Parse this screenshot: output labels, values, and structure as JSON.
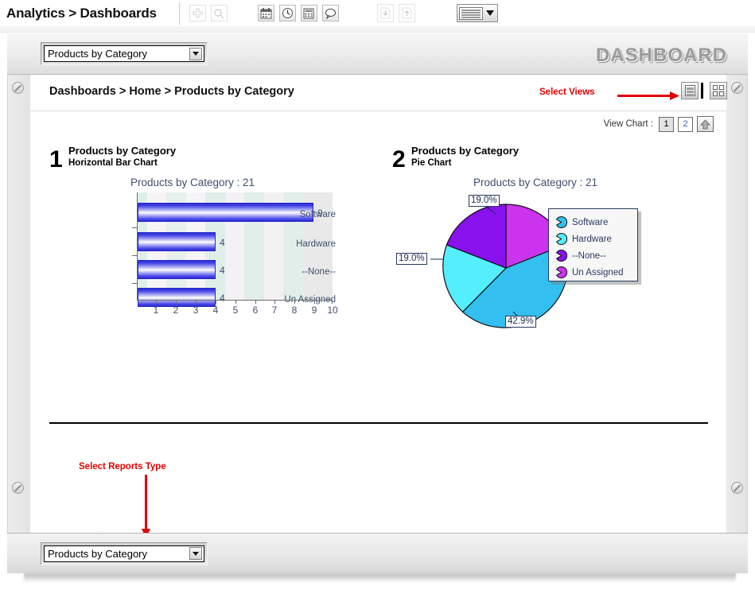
{
  "appbar": {
    "title": "Analytics > Dashboards",
    "icons": [
      {
        "name": "add-icon",
        "glyph": "plus",
        "disabled": true
      },
      {
        "name": "search-icon",
        "glyph": "magnifier",
        "disabled": true
      },
      {
        "name": "calendar-icon",
        "glyph": "calendar",
        "disabled": false
      },
      {
        "name": "clock-icon",
        "glyph": "clock",
        "disabled": false
      },
      {
        "name": "calculator-icon",
        "glyph": "calculator",
        "disabled": false
      },
      {
        "name": "comment-icon",
        "glyph": "speech-bubble",
        "disabled": false
      },
      {
        "name": "download-icon",
        "glyph": "down-arrow",
        "disabled": true
      },
      {
        "name": "upload-icon",
        "glyph": "up-arrow",
        "disabled": true
      }
    ],
    "view_select_label": "list-view-dropdown"
  },
  "top_strip": {
    "dashboard_select": {
      "value": "Products by Category",
      "placeholder": "Products by Category"
    },
    "brand": "DASHBOARD"
  },
  "content": {
    "breadcrumb": "Dashboards > Home > Products by Category",
    "select_views_label": "Select Views",
    "view_icons": [
      {
        "name": "view-list-icon",
        "active": true
      },
      {
        "name": "view-grid-icon",
        "active": false
      }
    ],
    "view_chart": {
      "label": "View Chart :",
      "buttons": [
        "1",
        "2"
      ],
      "active": "1",
      "collapse_icon": "up-arrow-icon"
    },
    "divider": true,
    "select_reports_label": "Select Reports Type"
  },
  "bottom_strip": {
    "report_select": {
      "value": "Products by Category",
      "placeholder": "Products by Category"
    }
  },
  "colors": {
    "software": "#33bfef",
    "hardware": "#55eeff",
    "none": "#8811ee",
    "unassigned": "#cc33ee",
    "bar_blue": "#2a2ad4",
    "annotation_red": "#e00000",
    "chart_text": "#414f70"
  },
  "chart_data": [
    {
      "type": "bar",
      "index": "1",
      "heading": "Products by Category",
      "subheading": "Horizontal Bar Chart",
      "title": "Products by Category : 21",
      "orientation": "horizontal",
      "categories": [
        "Software",
        "Hardware",
        "--None--",
        "Un Assigned"
      ],
      "values": [
        9,
        4,
        4,
        4
      ],
      "data_labels": [
        "9",
        "4",
        "4",
        "4"
      ],
      "xlabel": "",
      "ylabel": "",
      "xlim": [
        0,
        10
      ],
      "xticks": [
        "1",
        "2",
        "3",
        "4",
        "5",
        "6",
        "7",
        "8",
        "9",
        "10"
      ],
      "grid": "alternating-vertical-bands",
      "total": 21
    },
    {
      "type": "pie",
      "index": "2",
      "heading": "Products by Category",
      "subheading": "Pie Chart",
      "title": "Products by Category : 21",
      "labels": [
        "Software",
        "Hardware",
        "--None--",
        "Un Assigned"
      ],
      "values": [
        9,
        4,
        4,
        4
      ],
      "percentages": [
        "42.9%",
        "19.0%",
        "19.0%",
        "19.0%"
      ],
      "visible_callouts": [
        "19.0%",
        "19.0%",
        "42.9%"
      ],
      "colors": [
        "#33bfef",
        "#55eeff",
        "#8811ee",
        "#cc33ee"
      ],
      "legend_position": "right",
      "total": 21
    }
  ]
}
